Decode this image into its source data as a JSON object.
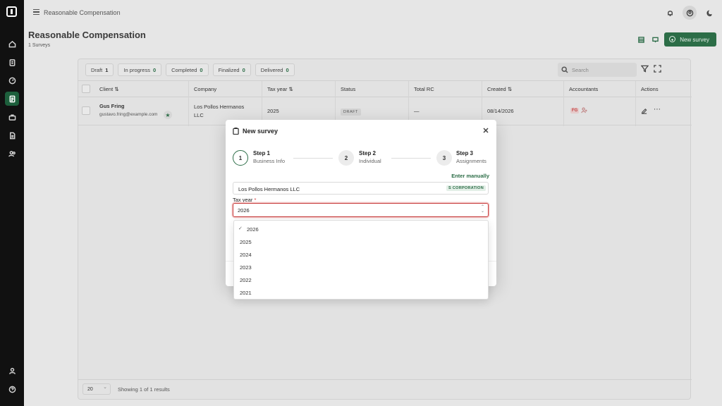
{
  "header": {
    "breadcrumb": "Reasonable Compensation"
  },
  "page": {
    "title": "Reasonable Compensation",
    "subtitle": "1 Surveys",
    "new_survey_label": "New survey"
  },
  "filters": [
    {
      "label": "Draft",
      "count": "1"
    },
    {
      "label": "In progress",
      "count": "0"
    },
    {
      "label": "Completed",
      "count": "0"
    },
    {
      "label": "Finalized",
      "count": "0"
    },
    {
      "label": "Delivered",
      "count": "0"
    }
  ],
  "search": {
    "placeholder": "Search"
  },
  "table": {
    "columns": [
      "Client ⇅",
      "Company",
      "Tax year ⇅",
      "Status",
      "Total RC",
      "Created ⇅",
      "Accountants",
      "Actions"
    ],
    "rows": [
      {
        "client_name": "Gus Fring",
        "client_email": "gustavo.fring@example.com",
        "company_line1": "Los Pollos Hermanos",
        "company_line2": "LLC",
        "tax_year": "2025",
        "status": "DRAFT",
        "total_rc": "—",
        "created": "08/14/2026",
        "accountant": "FG"
      }
    ]
  },
  "footer": {
    "page_size": "20",
    "showing": "Showing 1 of 1 results"
  },
  "modal": {
    "title": "New survey",
    "steps": [
      {
        "number": "1",
        "name": "Step 1",
        "desc": "Business Info"
      },
      {
        "number": "2",
        "name": "Step 2",
        "desc": "Individual"
      },
      {
        "number": "3",
        "name": "Step 3",
        "desc": "Assignments"
      }
    ],
    "enter_manually": "Enter manually",
    "company_value": "Los Pollos Hermanos LLC",
    "company_badge": "S CORPORATION",
    "tax_year_label": "Tax year",
    "required_mark": "*",
    "tax_year_value": "2026"
  },
  "dropdown": {
    "options": [
      "2026",
      "2025",
      "2024",
      "2023",
      "2022",
      "2021"
    ],
    "selected_check": "✓"
  },
  "colors": {
    "brand_green": "#2c6d47",
    "error_red": "#c83a3a"
  }
}
